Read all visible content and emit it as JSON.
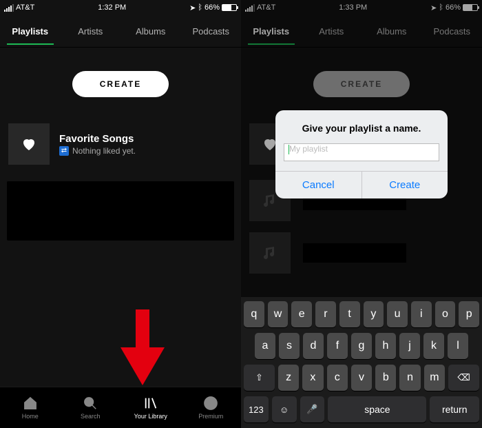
{
  "left": {
    "status": {
      "carrier": "AT&T",
      "time": "1:32 PM",
      "battery": "66%"
    },
    "tabs": [
      "Playlists",
      "Artists",
      "Albums",
      "Podcasts"
    ],
    "active_tab": 0,
    "create_label": "CREATE",
    "favorite": {
      "title": "Favorite Songs",
      "subtitle": "Nothing liked yet."
    },
    "nav": [
      {
        "label": "Home",
        "icon": "home-icon"
      },
      {
        "label": "Search",
        "icon": "search-icon"
      },
      {
        "label": "Your Library",
        "icon": "library-icon"
      },
      {
        "label": "Premium",
        "icon": "spotify-icon"
      }
    ],
    "active_nav": 2
  },
  "right": {
    "status": {
      "carrier": "AT&T",
      "time": "1:33 PM",
      "battery": "66%"
    },
    "tabs": [
      "Playlists",
      "Artists",
      "Albums",
      "Podcasts"
    ],
    "active_tab": 0,
    "create_label": "CREATE",
    "modal": {
      "title": "Give your playlist a name.",
      "placeholder": "My playlist",
      "cancel": "Cancel",
      "create": "Create"
    },
    "keyboard": {
      "row1": [
        "q",
        "w",
        "e",
        "r",
        "t",
        "y",
        "u",
        "i",
        "o",
        "p"
      ],
      "row2": [
        "a",
        "s",
        "d",
        "f",
        "g",
        "h",
        "j",
        "k",
        "l"
      ],
      "row3": [
        "z",
        "x",
        "c",
        "v",
        "b",
        "n",
        "m"
      ],
      "shift": "⇧",
      "backspace": "⌫",
      "numbers": "123",
      "emoji": "☺",
      "mic": "🎤",
      "space": "space",
      "return": "return"
    }
  }
}
